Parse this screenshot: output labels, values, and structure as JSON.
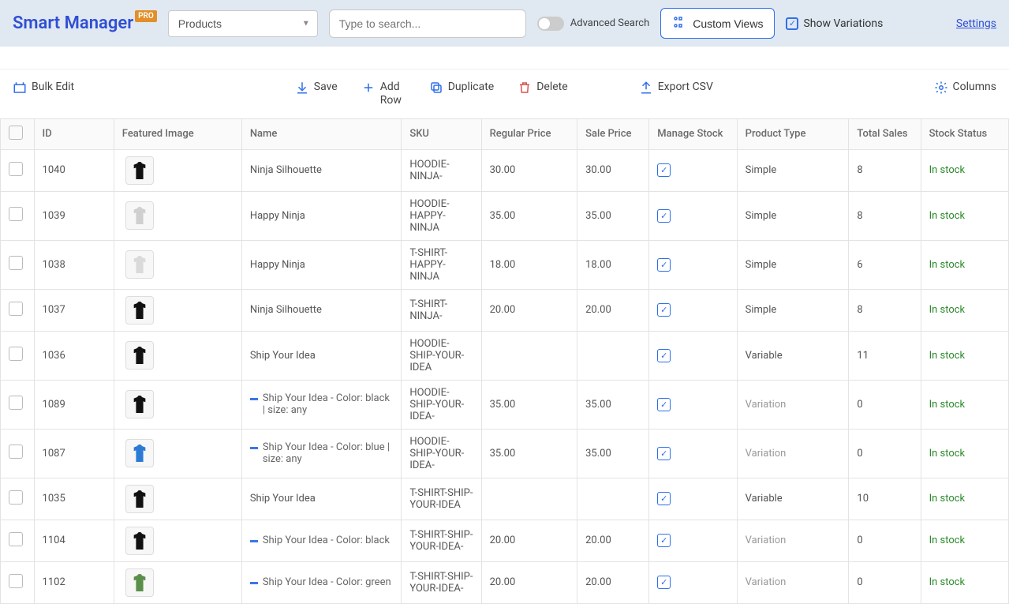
{
  "brand": {
    "name": "Smart Manager",
    "badge": "PRO"
  },
  "header": {
    "dashboard_select": "Products",
    "search_placeholder": "Type to search...",
    "advanced_search_label": "Advanced Search",
    "custom_views_label": "Custom Views",
    "show_variations_label": "Show Variations",
    "settings_link": "Settings"
  },
  "toolbar": {
    "bulk_edit": "Bulk Edit",
    "save": "Save",
    "add_row": "Add Row",
    "duplicate": "Duplicate",
    "delete": "Delete",
    "export_csv": "Export CSV",
    "columns": "Columns"
  },
  "columns": {
    "id": "ID",
    "featured_image": "Featured Image",
    "name": "Name",
    "sku": "SKU",
    "regular_price": "Regular Price",
    "sale_price": "Sale Price",
    "manage_stock": "Manage Stock",
    "product_type": "Product Type",
    "total_sales": "Total Sales",
    "stock_status": "Stock Status"
  },
  "rows": [
    {
      "id": "1040",
      "name": "Ninja Silhouette",
      "sku": "HOODIE-NINJA-",
      "regular_price": "30.00",
      "sale_price": "30.00",
      "manage_stock": true,
      "product_type": "Simple",
      "is_variation": false,
      "total_sales": "8",
      "stock_status": "In stock",
      "thumb": "black"
    },
    {
      "id": "1039",
      "name": "Happy Ninja",
      "sku": "HOODIE-HAPPY-NINJA",
      "regular_price": "35.00",
      "sale_price": "35.00",
      "manage_stock": true,
      "product_type": "Simple",
      "is_variation": false,
      "total_sales": "8",
      "stock_status": "In stock",
      "thumb": "grey"
    },
    {
      "id": "1038",
      "name": "Happy Ninja",
      "sku": "T-SHIRT-HAPPY-NINJA",
      "regular_price": "18.00",
      "sale_price": "18.00",
      "manage_stock": true,
      "product_type": "Simple",
      "is_variation": false,
      "total_sales": "6",
      "stock_status": "In stock",
      "thumb": "lightgrey"
    },
    {
      "id": "1037",
      "name": "Ninja Silhouette",
      "sku": "T-SHIRT-NINJA-",
      "regular_price": "20.00",
      "sale_price": "20.00",
      "manage_stock": true,
      "product_type": "Simple",
      "is_variation": false,
      "total_sales": "8",
      "stock_status": "In stock",
      "thumb": "black"
    },
    {
      "id": "1036",
      "name": "Ship Your Idea",
      "sku": "HOODIE-SHIP-YOUR-IDEA",
      "regular_price": "",
      "sale_price": "",
      "manage_stock": true,
      "product_type": "Variable",
      "is_variation": false,
      "total_sales": "11",
      "stock_status": "In stock",
      "thumb": "black"
    },
    {
      "id": "1089",
      "name": "Ship Your Idea - Color: black | size: any",
      "sku": "HOODIE-SHIP-YOUR-IDEA-",
      "regular_price": "35.00",
      "sale_price": "35.00",
      "manage_stock": true,
      "product_type": "Variation",
      "is_variation": true,
      "total_sales": "0",
      "stock_status": "In stock",
      "thumb": "black"
    },
    {
      "id": "1087",
      "name": "Ship Your Idea - Color: blue | size: any",
      "sku": "HOODIE-SHIP-YOUR-IDEA-",
      "regular_price": "35.00",
      "sale_price": "35.00",
      "manage_stock": true,
      "product_type": "Variation",
      "is_variation": true,
      "total_sales": "0",
      "stock_status": "In stock",
      "thumb": "blue"
    },
    {
      "id": "1035",
      "name": "Ship Your Idea",
      "sku": "T-SHIRT-SHIP-YOUR-IDEA",
      "regular_price": "",
      "sale_price": "",
      "manage_stock": true,
      "product_type": "Variable",
      "is_variation": false,
      "total_sales": "10",
      "stock_status": "In stock",
      "thumb": "black"
    },
    {
      "id": "1104",
      "name": "Ship Your Idea - Color: black",
      "sku": "T-SHIRT-SHIP-YOUR-IDEA-",
      "regular_price": "20.00",
      "sale_price": "20.00",
      "manage_stock": true,
      "product_type": "Variation",
      "is_variation": true,
      "total_sales": "0",
      "stock_status": "In stock",
      "thumb": "black"
    },
    {
      "id": "1102",
      "name": "Ship Your Idea - Color: green",
      "sku": "T-SHIRT-SHIP-YOUR-IDEA-",
      "regular_price": "20.00",
      "sale_price": "20.00",
      "manage_stock": true,
      "product_type": "Variation",
      "is_variation": true,
      "total_sales": "0",
      "stock_status": "In stock",
      "thumb": "green"
    }
  ],
  "thumb_colors": {
    "black": "#111",
    "grey": "#cfcfcf",
    "lightgrey": "#dadada",
    "blue": "#2b7bd6",
    "green": "#5a8f4a"
  }
}
